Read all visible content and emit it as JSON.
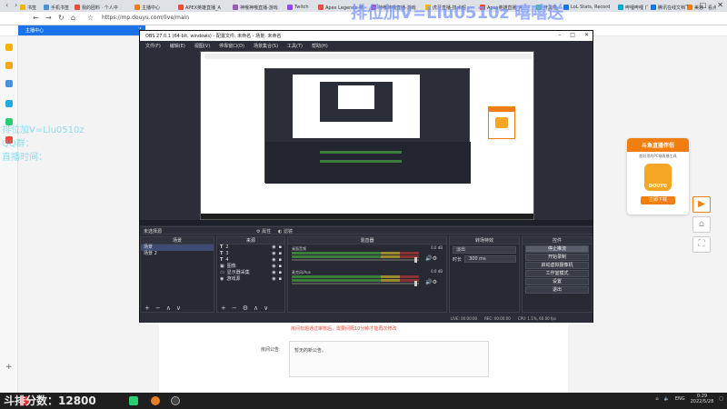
{
  "browser": {
    "tabs": [
      {
        "label": "书签",
        "color": "#f5b400"
      },
      {
        "label": "手机书签",
        "color": "#4a90d9"
      },
      {
        "label": "我的团料 · 个人中",
        "color": "#e74c3c"
      },
      {
        "label": "主播中心",
        "color": "#f17e11"
      },
      {
        "label": "APEX英雄直播_A",
        "color": "#e74c3c"
      },
      {
        "label": "神哦神哦直播-游戏",
        "color": "#9b59b6"
      },
      {
        "label": "Twitch",
        "color": "#9146ff"
      },
      {
        "label": "Apex Legends 英",
        "color": "#e74c3c"
      },
      {
        "label": "神哦神哦直播-游戏",
        "color": "#9b59b6"
      },
      {
        "label": "虎牙直播-技术超",
        "color": "#f5b400"
      },
      {
        "label": "Apex英雄直播_A",
        "color": "#e74c3c"
      },
      {
        "label": "开黑啦",
        "color": "#2ecc71"
      },
      {
        "label": "LoL Stats, Record",
        "color": "#1a73e8"
      },
      {
        "label": "哔哩哔哩 (゜-゜)つ",
        "color": "#00a1d6"
      },
      {
        "label": "腾讯在线文档",
        "color": "#1a73e8"
      },
      {
        "label": "美通 - 看点小",
        "color": "#f17e11"
      }
    ],
    "url": "https://mp.douyu.com/live/main",
    "active_tab": "主播中心"
  },
  "page": {
    "warning": "房间标题通过审核后，需要间隔10分钟才能再次修改",
    "notice_label": "房间公告:",
    "notice_text": "暂无的新公告。",
    "promo": {
      "title": "斗鱼直播伴侣",
      "subtitle": "超好用的PC端直播工具",
      "logo_text": "DOUYU",
      "button": "立即下载"
    }
  },
  "obs": {
    "title": "OBS 27.0.1 (64-bit, windows) - 配置文件: 未命名 - 场景: 未命名",
    "menu": [
      "文件(F)",
      "编辑(E)",
      "视图(V)",
      "停靠窗口(D)",
      "场景集合(S)",
      "工具(T)",
      "帮助(H)"
    ],
    "no_source": "未选择源",
    "props_btn": "属性",
    "filters_btn": "滤镜",
    "scenes_header": "场景",
    "scenes": [
      "场景",
      "场景 2"
    ],
    "sources_header": "来源",
    "sources": [
      {
        "icon": "T",
        "name": "2"
      },
      {
        "icon": "T",
        "name": "3"
      },
      {
        "icon": "T",
        "name": "4"
      },
      {
        "icon": "▣",
        "name": "图像"
      },
      {
        "icon": "▭",
        "name": "显示器采集"
      },
      {
        "icon": "◉",
        "name": "游戏源"
      }
    ],
    "mixer_header": "混音器",
    "mixer": [
      {
        "name": "桌面音频",
        "db": "0.0 dB"
      },
      {
        "name": "麦克风/Aux",
        "db": "0.0 dB"
      }
    ],
    "transitions_header": "转场特效",
    "transition_type": "淡出",
    "duration_label": "时长",
    "duration_value": "300 ms",
    "controls_header": "控件",
    "controls": [
      "停止推流",
      "开始录制",
      "启动虚拟摄像机",
      "工作室模式",
      "设置",
      "退出"
    ],
    "status": [
      "LIVE: 00:00:00",
      "REC: 00:00:00",
      "CPU: 1.1%, 60.00 fps"
    ]
  },
  "overlay": {
    "top": "排位加V=Llu0510z  嘻嘻送",
    "left": "排位加V=Llu0510z\nQQ群：\n直播时间：",
    "bottom": "斗排分数：12800"
  },
  "taskbar": {
    "lang": "ENG",
    "time": "0:29",
    "date": "2022/5/28"
  }
}
